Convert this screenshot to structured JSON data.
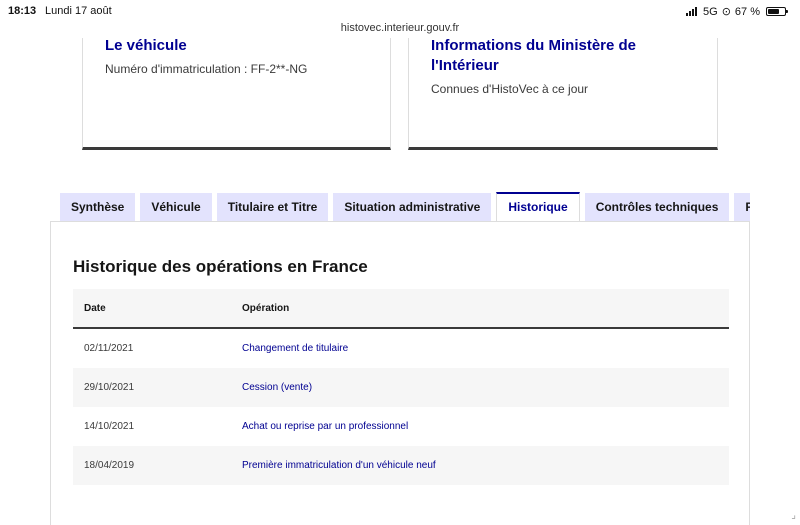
{
  "status_bar": {
    "time": "18:13",
    "date": "Lundi 17 août",
    "network": "5G",
    "battery": "67 %",
    "battery_level": 0.67
  },
  "browser": {
    "url": "histovec.interieur.gouv.fr"
  },
  "cards": [
    {
      "title": "Le véhicule",
      "text": "Numéro d'immatriculation : FF-2**-NG"
    },
    {
      "title": "Informations du Ministère de l'Intérieur",
      "text": "Connues d'HistoVec à ce jour"
    }
  ],
  "tabs": [
    {
      "label": "Synthèse",
      "active": false
    },
    {
      "label": "Véhicule",
      "active": false
    },
    {
      "label": "Titulaire et Titre",
      "active": false
    },
    {
      "label": "Situation administrative",
      "active": false
    },
    {
      "label": "Historique",
      "active": true
    },
    {
      "label": "Contrôles techniques",
      "active": false
    },
    {
      "label": "Rap",
      "active": false
    }
  ],
  "section": {
    "title": "Historique des opérations en France",
    "table": {
      "headers": [
        "Date",
        "Opération"
      ],
      "rows": [
        [
          "02/11/2021",
          "Changement de titulaire"
        ],
        [
          "29/10/2021",
          "Cession (vente)"
        ],
        [
          "14/10/2021",
          "Achat ou reprise par un professionnel"
        ],
        [
          "18/04/2019",
          "Première immatriculation d'un véhicule neuf"
        ]
      ]
    }
  },
  "colors": {
    "accent": "#000091",
    "tab_bg": "#e3e3fd",
    "row_alt": "#f6f6f6"
  }
}
